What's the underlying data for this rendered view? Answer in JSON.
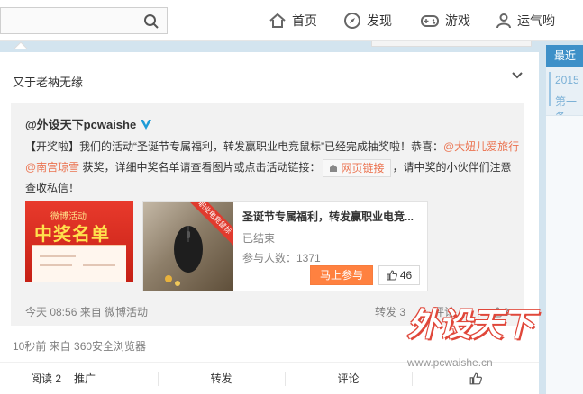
{
  "nav": {
    "home": "首页",
    "discover": "发现",
    "games": "游戏",
    "user": "运气哟"
  },
  "post": {
    "title": "又于老衲无缘",
    "meta": "10秒前 来自 360安全浏览器"
  },
  "repost": {
    "author": "@外设天下pcwaishe",
    "text_1": "【开奖啦】我们的活动“圣诞节专属福利，转发赢职业电竞鼠标”已经完成抽奖啦！恭喜：",
    "mention_1": "@大妞儿爱旅行",
    "mention_2": "@南宫琼雪",
    "text_2": " 获奖，详细中奖名单请查看图片或点击活动链接：",
    "web_link": "网页链接",
    "text_3": "，请中奖的小伙伴们注意查收私信！",
    "meta": "今天 08:56 来自 微博活动",
    "actions": {
      "repost": "转发 3",
      "comment": "评论 4",
      "like": "3"
    }
  },
  "thumb1": {
    "sub": "微博活动",
    "main": "中奖名单"
  },
  "link_card": {
    "ribbon": "职业电竞鼠标",
    "title": "圣诞节专属福利，转发赢职业电竞...",
    "status": "已结束",
    "count": "参与人数：1371",
    "join": "马上参与",
    "likes": "46"
  },
  "footer": {
    "read": "阅读 2",
    "promote": "推广",
    "repost": "转发",
    "comment": "评论"
  },
  "right": {
    "tab": "最近",
    "year": "2015",
    "day": "第一条"
  },
  "watermark": {
    "main": "外设天下",
    "url": "www.pcwaishe.cn"
  },
  "colors": {
    "accent": "#eb7350",
    "button": "#ff8140",
    "sidebar_tab": "#3e90c8",
    "verified": "#1d9bd7"
  }
}
